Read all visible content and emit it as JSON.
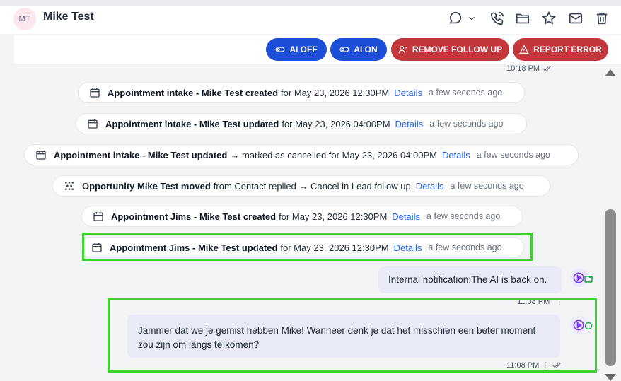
{
  "header": {
    "avatar_initials": "MT",
    "contact_name": "Mike Test",
    "icons": [
      "chat-bubble-icon",
      "chevron-down-icon",
      "phone-icon",
      "folder-icon",
      "star-icon",
      "mail-icon",
      "trash-icon"
    ]
  },
  "actions": {
    "ai_off_label": "AI OFF",
    "ai_on_label": "AI ON",
    "remove_followup_label": "REMOVE FOLLOW UP",
    "report_error_label": "REPORT ERROR"
  },
  "colors": {
    "primary_blue": "#1d4ed8",
    "danger_red": "#c2363c",
    "highlight_green": "#3cd42a",
    "link_blue": "#2563eb",
    "bubble_bg": "#e8eaf6"
  },
  "timeline": {
    "top_time": "10:18 PM",
    "events": [
      {
        "icon": "calendar-icon",
        "title": "Appointment intake - Mike Test created",
        "rest": "for May 23, 2026 12:30PM",
        "link": "Details",
        "ago": "a few seconds ago"
      },
      {
        "icon": "calendar-icon",
        "title": "Appointment intake - Mike Test updated",
        "rest": "for May 23, 2026 04:00PM",
        "link": "Details",
        "ago": "a few seconds ago"
      },
      {
        "icon": "calendar-icon",
        "title": "Appointment intake - Mike Test updated",
        "rest": "→ marked as cancelled for May 23, 2026 04:00PM",
        "link": "Details",
        "ago": "a few seconds ago"
      },
      {
        "icon": "pipeline-icon",
        "title": "Opportunity Mike Test moved",
        "rest": "from Contact replied → Cancel in Lead follow up",
        "link": "Details",
        "ago": "a few seconds ago"
      },
      {
        "icon": "calendar-icon",
        "title": "Appointment Jims - Mike Test created",
        "rest": "for May 23, 2026 12:30PM",
        "link": "Details",
        "ago": "a few seconds ago"
      },
      {
        "icon": "calendar-icon",
        "title": "Appointment Jims - Mike Test updated",
        "rest": "for May 23, 2026 12:30PM",
        "link": "Details",
        "ago": "a few seconds ago"
      }
    ],
    "notification": {
      "text": "Internal notification:The AI is back on.",
      "time": "11:08 PM"
    },
    "message": {
      "line1": "Jammer dat we je gemist hebben Mike! Wanneer denk je dat het misschien een beter moment",
      "line2": "zou zijn om langs te komen?",
      "time": "11:08 PM"
    }
  }
}
